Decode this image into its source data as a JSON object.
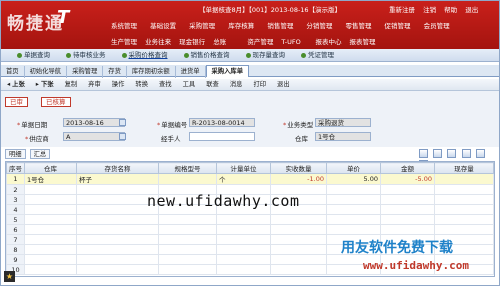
{
  "banner": {
    "logo": "畅捷通",
    "logo_t": "T",
    "info_text": "【单据核查8月】【001】2013-08-16【演示版】",
    "actions": [
      "重新注册",
      "注销",
      "帮助",
      "退出"
    ]
  },
  "menu1": [
    "系统管理",
    "基础设置",
    "采购管理",
    "库存核算",
    "销售管理",
    "分销管理",
    "零售管理",
    "促销管理",
    "会员管理"
  ],
  "menu2": [
    "生产管理",
    "业务往来",
    "现金银行",
    "总账",
    "资产管理",
    "T-UFO",
    "报表中心",
    "报表管理"
  ],
  "links": [
    {
      "label": "单据查询",
      "sel": false
    },
    {
      "label": "待审核业务",
      "sel": false
    },
    {
      "label": "采购价格查询",
      "sel": true
    },
    {
      "label": "销售价格查询",
      "sel": false
    },
    {
      "label": "现存量查询",
      "sel": false
    },
    {
      "label": "凭证管理",
      "sel": false
    }
  ],
  "tabs": [
    {
      "label": "首页",
      "active": false
    },
    {
      "label": "初始化导航",
      "active": false
    },
    {
      "label": "采购管理",
      "active": false
    },
    {
      "label": "存货",
      "active": false
    },
    {
      "label": "库存期初余额",
      "active": false
    },
    {
      "label": "进货单",
      "active": false
    },
    {
      "label": "采购入库单",
      "active": true
    }
  ],
  "toolbar": [
    "上张",
    "下张",
    "复制",
    "弃审",
    "操作",
    "转换",
    "查找",
    "工具",
    "联查",
    "消息",
    "打印",
    "退出"
  ],
  "flags": {
    "audited": "已审",
    "posted": "已核算"
  },
  "form": {
    "date_label": "单据日期",
    "date_value": "2013-08-16",
    "code_label": "单据编号",
    "code_value": "R-2013-08-0014",
    "biztype_label": "业务类型",
    "biztype_value": "采购退货",
    "vendor_label": "供应商",
    "vendor_value": "A",
    "handler_label": "经手人",
    "handler_value": "",
    "warehouse_label": "仓库",
    "warehouse_value": "1号仓"
  },
  "detail_tabs": [
    "明细",
    "汇总"
  ],
  "grid": {
    "headers": [
      "序号",
      "仓库",
      "存货名称",
      "规格型号",
      "计量单位",
      "实收数量",
      "单价",
      "金额",
      "现存量"
    ],
    "rows": [
      [
        "1",
        "1号仓",
        "杯子",
        "",
        "个",
        "-1.00",
        "5.00",
        "-5.00",
        ""
      ],
      [
        "2",
        "",
        "",
        "",
        "",
        "",
        "",
        "",
        ""
      ],
      [
        "3",
        "",
        "",
        "",
        "",
        "",
        "",
        "",
        ""
      ],
      [
        "4",
        "",
        "",
        "",
        "",
        "",
        "",
        "",
        ""
      ],
      [
        "5",
        "",
        "",
        "",
        "",
        "",
        "",
        "",
        ""
      ],
      [
        "6",
        "",
        "",
        "",
        "",
        "",
        "",
        "",
        ""
      ],
      [
        "7",
        "",
        "",
        "",
        "",
        "",
        "",
        "",
        ""
      ],
      [
        "8",
        "",
        "",
        "",
        "",
        "",
        "",
        "",
        ""
      ],
      [
        "9",
        "",
        "",
        "",
        "",
        "",
        "",
        "",
        ""
      ],
      [
        "10",
        "",
        "",
        "",
        "",
        "",
        "",
        "",
        ""
      ]
    ]
  },
  "watermarks": {
    "url": "new.ufidawhy.com",
    "cn": "用友软件免费下载",
    "url2": "www.ufidawhy.com"
  }
}
